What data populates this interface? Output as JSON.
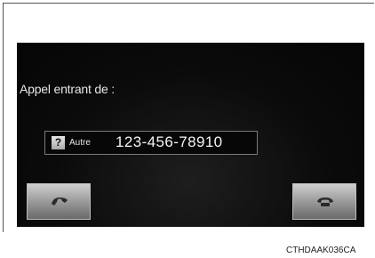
{
  "incoming_call": {
    "heading": "Appel entrant de :",
    "caller_type": "Autre",
    "phone_number": "123-456-78910",
    "contact_icon_glyph": "?",
    "answer_button_icon": "phone-answer-icon",
    "decline_button_icon": "phone-hangup-icon"
  },
  "caption": "CTHDAAK036CA"
}
